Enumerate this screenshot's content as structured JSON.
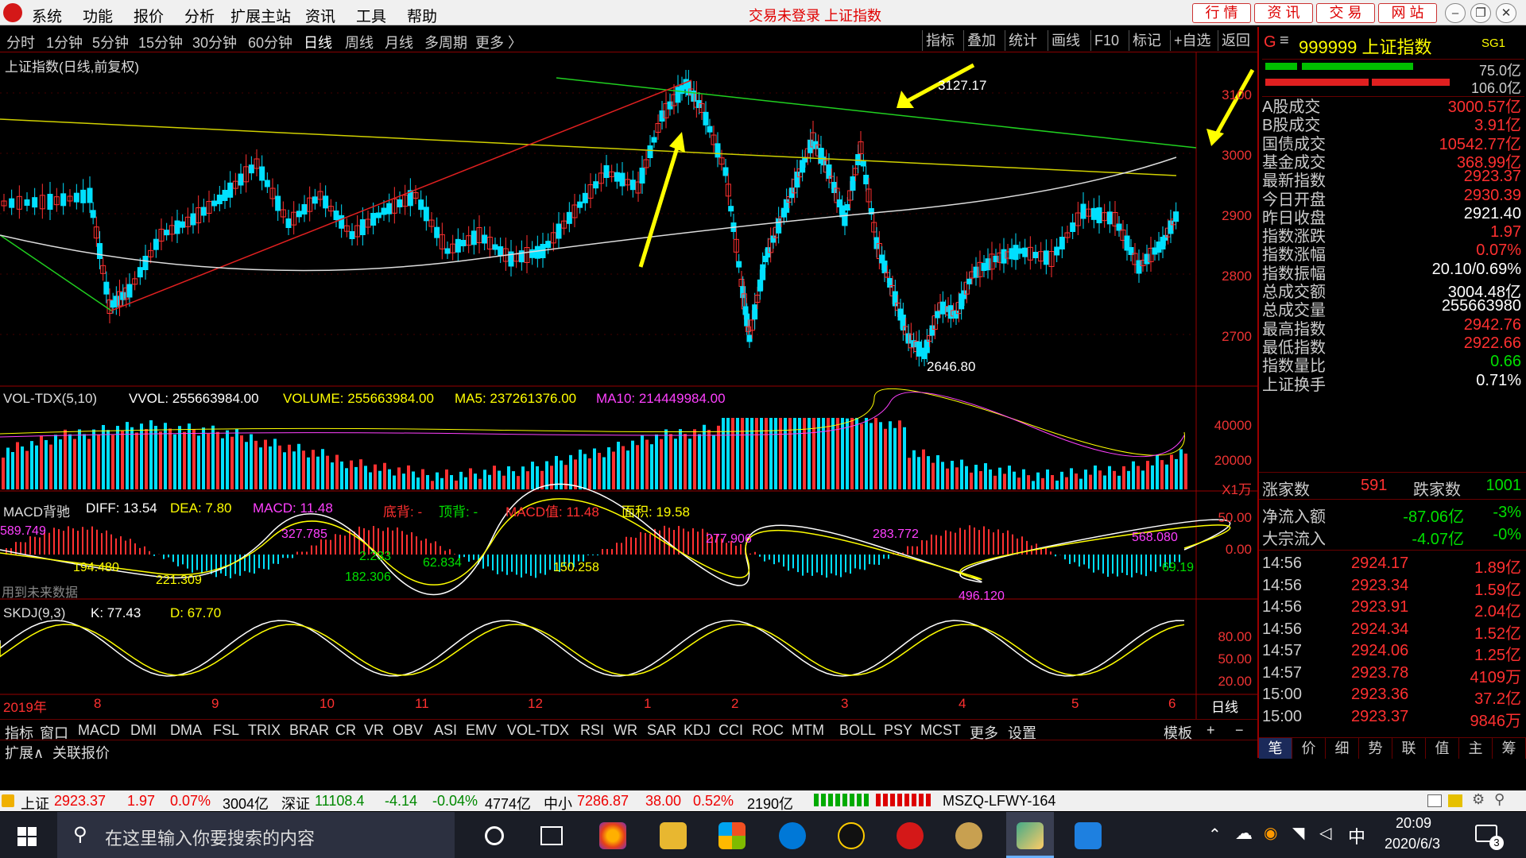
{
  "menubar": {
    "items": [
      "系统",
      "功能",
      "报价",
      "分析",
      "扩展主站",
      "资讯",
      "工具",
      "帮助"
    ],
    "title": "交易未登录  上证指数",
    "quick_buttons": [
      "行 情",
      "资 讯",
      "交 易",
      "网 站"
    ]
  },
  "periodbar": {
    "periods": [
      "分时",
      "1分钟",
      "5分钟",
      "15分钟",
      "30分钟",
      "60分钟",
      "日线",
      "周线",
      "月线",
      "多周期",
      "更多 〉"
    ],
    "active": "日线",
    "tools": [
      "指标",
      "叠加",
      "统计",
      "画线",
      "F10",
      "标记",
      "+自选",
      "返回"
    ]
  },
  "chart": {
    "title": "上证指数(日线,前复权)",
    "high_label": "3127.17",
    "low_label": "2646.80",
    "price_axis": [
      "3100",
      "3000",
      "2900",
      "2800",
      "2700"
    ],
    "volume_panel": {
      "name": "VOL-TDX(5,10)",
      "vvol": "VVOL: 255663984.00",
      "volume": "VOLUME: 255663984.00",
      "ma5": "MA5: 237261376.00",
      "ma10": "MA10: 214449984.00",
      "axis": [
        "40000",
        "20000"
      ],
      "unit": "X1万"
    },
    "macd_panel": {
      "name": "MACD背驰",
      "diff": "DIFF: 13.54",
      "dea": "DEA: 7.80",
      "macd": "MACD: 11.48",
      "bottom": "底背: -",
      "top": "顶背: -",
      "macd_val": "MACD值: 11.48",
      "area": "面积: 19.58",
      "axis": [
        "50.00",
        "0.00"
      ],
      "note": "用到未来数据",
      "labels": [
        "589.749",
        "194.480",
        "221.309",
        "327.785",
        "2.233",
        "182.306",
        "62.834",
        "150.258",
        "277.906",
        "283.772",
        "496.120",
        "568.080",
        "69.19"
      ]
    },
    "skdj_panel": {
      "name": "SKDJ(9,3)",
      "k": "K: 77.43",
      "d": "D: 67.70",
      "axis": [
        "80.00",
        "50.00",
        "20.00"
      ]
    },
    "date_axis": [
      "2019年",
      "8",
      "9",
      "10",
      "11",
      "12",
      "1",
      "2",
      "3",
      "4",
      "5",
      "6"
    ],
    "period_tag": "日线"
  },
  "indicator_bar": {
    "items": [
      "指标",
      "窗口",
      "MACD",
      "DMI",
      "DMA",
      "FSL",
      "TRIX",
      "BRAR",
      "CR",
      "VR",
      "OBV",
      "ASI",
      "EMV",
      "VOL-TDX",
      "RSI",
      "WR",
      "SAR",
      "KDJ",
      "CCI",
      "ROC",
      "MTM",
      "BOLL",
      "PSY",
      "MCST",
      "更多",
      "设置"
    ],
    "template": "模板"
  },
  "expand_bar": {
    "items": [
      "扩展∧",
      "关联报价"
    ]
  },
  "right_panel": {
    "header": "999999 上证指数",
    "sg": "SG1",
    "bar_top": "75.0亿",
    "bar_bottom": "106.0亿",
    "stats": [
      {
        "k": "A股成交",
        "v": "3000.57亿",
        "c": "red"
      },
      {
        "k": "B股成交",
        "v": "3.91亿",
        "c": "red"
      },
      {
        "k": "国债成交",
        "v": "10542.77亿",
        "c": "red"
      },
      {
        "k": "基金成交",
        "v": "368.99亿",
        "c": "red"
      },
      {
        "k": "最新指数",
        "v": "2923.37",
        "c": "red"
      },
      {
        "k": "今日开盘",
        "v": "2930.39",
        "c": "red"
      },
      {
        "k": "昨日收盘",
        "v": "2921.40",
        "c": "white"
      },
      {
        "k": "指数涨跌",
        "v": "1.97",
        "c": "red"
      },
      {
        "k": "指数涨幅",
        "v": "0.07%",
        "c": "red"
      },
      {
        "k": "指数振幅",
        "v": "20.10/0.69%",
        "c": "white"
      },
      {
        "k": "总成交额",
        "v": "3004.48亿",
        "c": "white"
      },
      {
        "k": "总成交量",
        "v": "255663980",
        "c": "white"
      },
      {
        "k": "最高指数",
        "v": "2942.76",
        "c": "red"
      },
      {
        "k": "最低指数",
        "v": "2922.66",
        "c": "red"
      },
      {
        "k": "指数量比",
        "v": "0.66",
        "c": "green"
      },
      {
        "k": "上证换手",
        "v": "0.71%",
        "c": "white"
      }
    ],
    "updown": {
      "up_label": "涨家数",
      "up": "591",
      "down_label": "跌家数",
      "down": "1001"
    },
    "flow": [
      {
        "k": "净流入额",
        "v": "-87.06亿",
        "p": "-3%"
      },
      {
        "k": "大宗流入",
        "v": "-4.07亿",
        "p": "-0%"
      }
    ],
    "ticks": [
      {
        "t": "14:56",
        "p": "2924.17",
        "v": "1.89亿"
      },
      {
        "t": "14:56",
        "p": "2923.34",
        "v": "1.59亿"
      },
      {
        "t": "14:56",
        "p": "2923.91",
        "v": "2.04亿"
      },
      {
        "t": "14:56",
        "p": "2924.34",
        "v": "1.52亿"
      },
      {
        "t": "14:57",
        "p": "2924.06",
        "v": "1.25亿"
      },
      {
        "t": "14:57",
        "p": "2923.78",
        "v": "4109万"
      },
      {
        "t": "15:00",
        "p": "2923.36",
        "v": "37.2亿"
      },
      {
        "t": "15:00",
        "p": "2923.37",
        "v": "9846万"
      }
    ],
    "tabs": [
      "笔",
      "价",
      "细",
      "势",
      "联",
      "值",
      "主",
      "筹"
    ]
  },
  "statusbar": {
    "sh_label": "上证",
    "sh_price": "2923.37",
    "sh_chg": "1.97",
    "sh_pct": "0.07%",
    "sh_amt": "3004亿",
    "sz_label": "深证",
    "sz_price": "11108.4",
    "sz_chg": "-4.14",
    "sz_pct": "-0.04%",
    "sz_amt": "4774亿",
    "zx_label": "中小",
    "zx_price": "7286.87",
    "zx_chg": "38.00",
    "zx_pct": "0.52%",
    "zx_amt": "2190亿",
    "server": "MSZQ-LFWY-164"
  },
  "taskbar": {
    "search_placeholder": "在这里输入你要搜索的内容",
    "ime": "中",
    "time": "20:09",
    "date": "2020/6/3",
    "notif_count": "3"
  }
}
